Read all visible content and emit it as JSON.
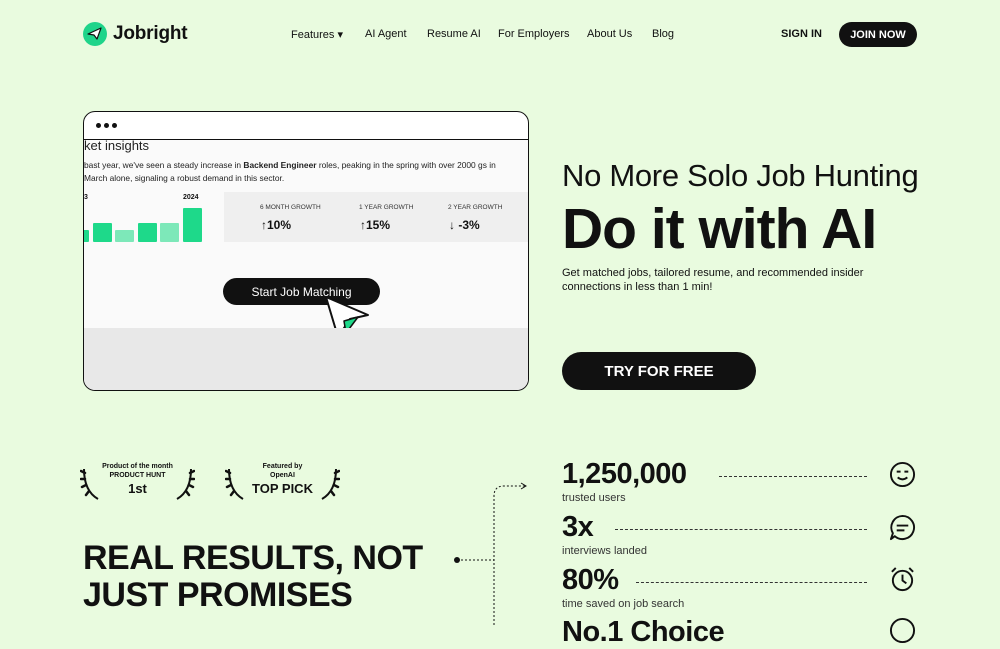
{
  "brand": {
    "name": "Jobright",
    "accent": "#1fd48a",
    "background": "#e9fbdf"
  },
  "nav": {
    "features": "Features ▾",
    "ai_agent": "AI Agent",
    "resume_ai": "Resume AI",
    "for_employers": "For Employers",
    "about_us": "About Us",
    "blog": "Blog",
    "sign_in": "SIGN IN",
    "join_now": "JOIN NOW"
  },
  "mock": {
    "title": "ket insights",
    "text_pre": "bast year, we've seen a steady increase in ",
    "text_bold": "Backend Engineer",
    "text_post": " roles, peaking in the spring with over 2000 gs in March alone, signaling a robust demand in this sector.",
    "year_left": "3",
    "year_right": "2024",
    "bars": [
      0.35,
      0.55,
      0.35,
      0.55,
      0.55,
      1.0
    ],
    "stats": [
      {
        "label": "6 MONTH GROWTH",
        "value": "↑10%"
      },
      {
        "label": "1 YEAR GROWTH",
        "value": "↑15%"
      },
      {
        "label": "2 YEAR GROWTH",
        "value": "↓ -3%"
      }
    ],
    "button": "Start Job Matching"
  },
  "hero": {
    "subtitle": "No More Solo Job Hunting",
    "title": "Do it with AI",
    "description": "Get matched jobs, tailored resume, and recommended insider connections in less than 1 min!",
    "cta": "TRY FOR FREE"
  },
  "badges": [
    {
      "line1": "Product of the month",
      "line2": "PRODUCT HUNT",
      "big": "1st"
    },
    {
      "line1": "Featured by",
      "line2": "OpenAI",
      "big": "TOP PICK"
    }
  ],
  "results_heading": "REAL RESULTS, NOT JUST PROMISES",
  "stats": [
    {
      "value": "1,250,000",
      "label": "trusted users",
      "icon": "smile-icon"
    },
    {
      "value": "3x",
      "label": "interviews landed",
      "icon": "chat-icon"
    },
    {
      "value": "80%",
      "label": "time saved on job search",
      "icon": "alarm-clock-icon"
    },
    {
      "value": "No.1 Choice",
      "label": "",
      "icon": "circle-icon"
    }
  ]
}
